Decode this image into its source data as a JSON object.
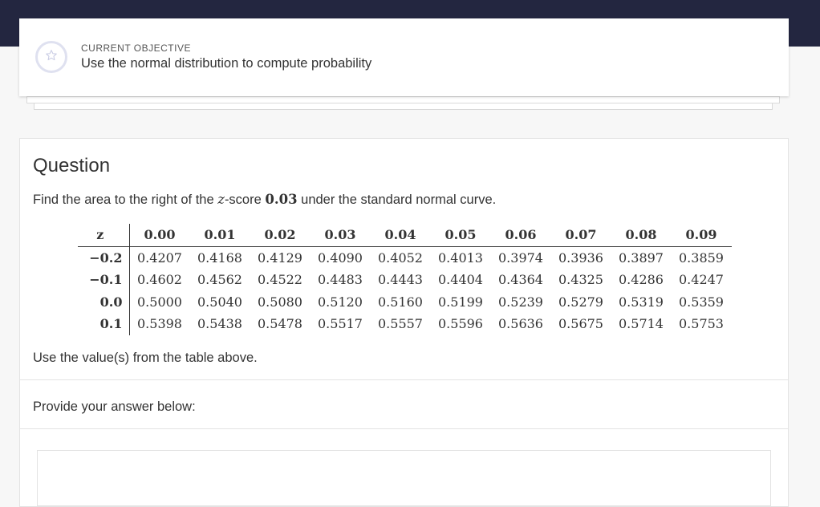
{
  "objective": {
    "icon": "star-icon",
    "label": "CURRENT OBJECTIVE",
    "text": "Use the normal distribution to compute probability"
  },
  "question": {
    "heading": "Question",
    "prompt_before": "Find the area to the right of the ",
    "prompt_var": "z",
    "prompt_mid": "-score ",
    "prompt_value": "0.03",
    "prompt_after": " under the standard normal curve.",
    "note": "Use the value(s) from the table above.",
    "answer_label": "Provide your answer below:"
  },
  "z_table": {
    "header": [
      "z",
      "0.00",
      "0.01",
      "0.02",
      "0.03",
      "0.04",
      "0.05",
      "0.06",
      "0.07",
      "0.08",
      "0.09"
    ],
    "rows": [
      [
        "−0.2",
        "0.4207",
        "0.4168",
        "0.4129",
        "0.4090",
        "0.4052",
        "0.4013",
        "0.3974",
        "0.3936",
        "0.3897",
        "0.3859"
      ],
      [
        "−0.1",
        "0.4602",
        "0.4562",
        "0.4522",
        "0.4483",
        "0.4443",
        "0.4404",
        "0.4364",
        "0.4325",
        "0.4286",
        "0.4247"
      ],
      [
        "0.0",
        "0.5000",
        "0.5040",
        "0.5080",
        "0.5120",
        "0.5160",
        "0.5199",
        "0.5239",
        "0.5279",
        "0.5319",
        "0.5359"
      ],
      [
        "0.1",
        "0.5398",
        "0.5438",
        "0.5478",
        "0.5517",
        "0.5557",
        "0.5596",
        "0.5636",
        "0.5675",
        "0.5714",
        "0.5753"
      ]
    ]
  },
  "colors": {
    "top_band": "#232640",
    "page_bg": "#f7f7f7",
    "card_bg": "#ffffff",
    "star_ring": "#dfe1f0"
  }
}
